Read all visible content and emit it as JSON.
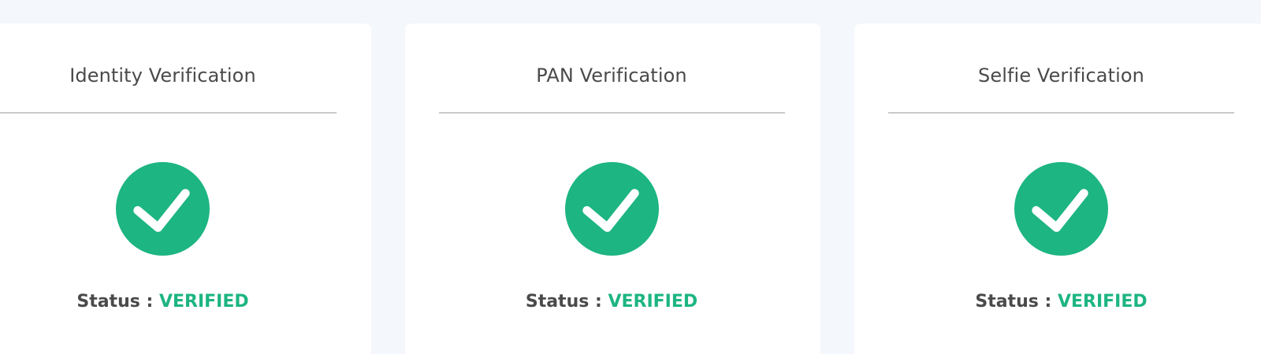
{
  "colors": {
    "page_background": "#f4f7fb",
    "card_background": "#ffffff",
    "success_green": "#1db581",
    "text_dark": "#4a4a4a",
    "divider": "#9e9e9e"
  },
  "cards": [
    {
      "title": "Identity Verification",
      "icon": "check-circle-icon",
      "status_label": "Status : ",
      "status_value": "VERIFIED"
    },
    {
      "title": "PAN Verification",
      "icon": "check-circle-icon",
      "status_label": "Status : ",
      "status_value": "VERIFIED"
    },
    {
      "title": "Selfie Verification",
      "icon": "check-circle-icon",
      "status_label": "Status : ",
      "status_value": "VERIFIED"
    }
  ]
}
